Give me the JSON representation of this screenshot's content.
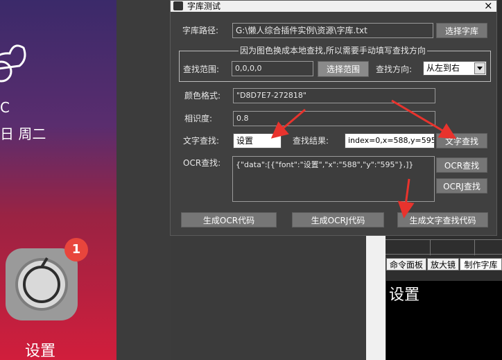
{
  "dialog": {
    "title": "字库测试",
    "close_glyph": "×",
    "path_label": "字库路径:",
    "path_value": "G:\\懒人综合插件实例\\资源\\字库.txt",
    "choose_lib_button": "选择字库",
    "group_title": "因为图色换成本地查找,所以需要手动填写查找方向",
    "range_label": "查找范围:",
    "range_value": "0,0,0,0",
    "choose_range_button": "选择范围",
    "direction_label": "查找方向:",
    "direction_value": "从左到右",
    "color_label": "颜色格式:",
    "color_value": "\"D8D7E7-272818\"",
    "similarity_label": "相识度:",
    "similarity_value": "0.8",
    "text_search_label": "文字查找:",
    "text_search_value": "设置",
    "result_label": "查找结果:",
    "result_value": "index=0,x=588,y=595",
    "text_search_button": "文字查找",
    "ocr_label": "OCR查找:",
    "ocr_value": "{\"data\":[{\"font\":\"设置\",\"x\":\"588\",\"y\":\"595\"},]}",
    "ocr_button": "OCR查找",
    "ocrj_button": "OCRJ查找",
    "gen_ocr_button": "生成OCR代码",
    "gen_ocrj_button": "生成OCRJ代码",
    "gen_text_button": "生成文字查找代码"
  },
  "phone": {
    "weather_suffix": "C",
    "date_text": "日 周二",
    "settings_label": "设置",
    "badge_count": "1"
  },
  "right_panel": {
    "tabs": [
      "命令面板",
      "放大镜",
      "制作字库"
    ],
    "preview_text": "设置"
  },
  "colors": {
    "arrow": "#e8332d",
    "badge": "#e8453c"
  }
}
